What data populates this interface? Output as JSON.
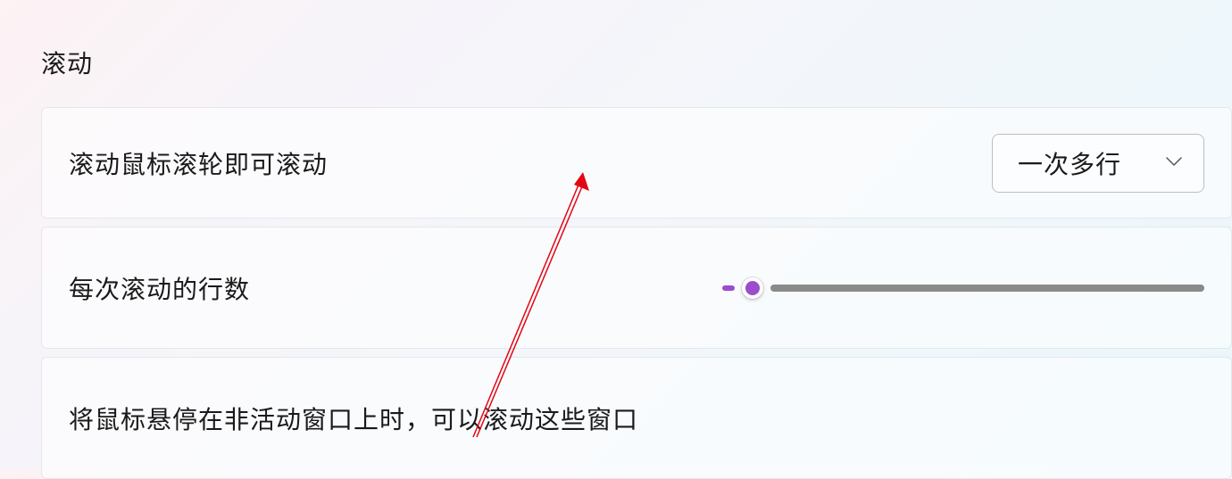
{
  "section": {
    "title": "滚动"
  },
  "settings": {
    "scroll_wheel": {
      "label": "滚动鼠标滚轮即可滚动",
      "selected": "一次多行"
    },
    "lines_per_scroll": {
      "label": "每次滚动的行数",
      "slider": {
        "min": 1,
        "max": 100,
        "value": 3
      }
    },
    "hover_inactive": {
      "label": "将鼠标悬停在非活动窗口上时，可以滚动这些窗口"
    }
  },
  "colors": {
    "accent": "#9c4dcc"
  }
}
